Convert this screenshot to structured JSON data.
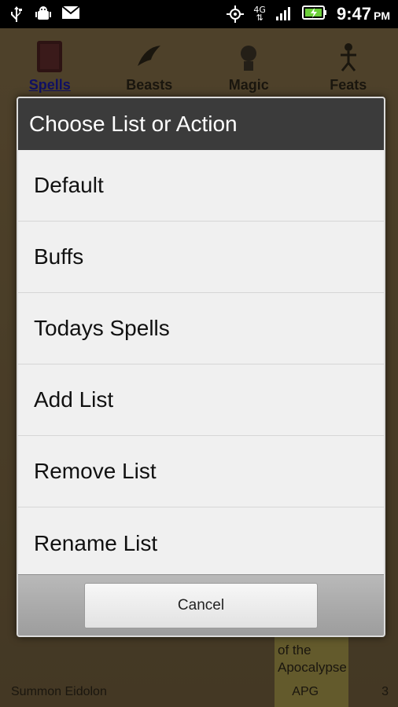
{
  "status_bar": {
    "time": "9:47",
    "ampm": "PM",
    "network": "4G",
    "left_icons": [
      "usb-icon",
      "android-debug-icon",
      "mail-icon"
    ],
    "right_icons": [
      "gps-icon",
      "network-4g-icon",
      "signal-icon",
      "battery-charging-icon"
    ]
  },
  "tabs": [
    {
      "label": "Spells",
      "icon": "spellbook-icon",
      "active": true
    },
    {
      "label": "Beasts",
      "icon": "beast-icon",
      "active": false
    },
    {
      "label": "Magic",
      "icon": "magic-icon",
      "active": false
    },
    {
      "label": "Feats",
      "icon": "feats-icon",
      "active": false
    }
  ],
  "background": {
    "highlight_text": "of the Apocalypse",
    "row": {
      "name": "Summon Eidolon",
      "source": "APG",
      "count": "3"
    }
  },
  "dialog": {
    "title": "Choose List or Action",
    "items": [
      "Default",
      "Buffs",
      "Todays Spells",
      "Add List",
      "Remove List",
      "Rename List"
    ],
    "cancel_label": "Cancel"
  },
  "colors": {
    "title_bar": "#3b3b3b",
    "dialog_bg": "#f0f0f0",
    "active_tab": "#1a1a9e"
  }
}
